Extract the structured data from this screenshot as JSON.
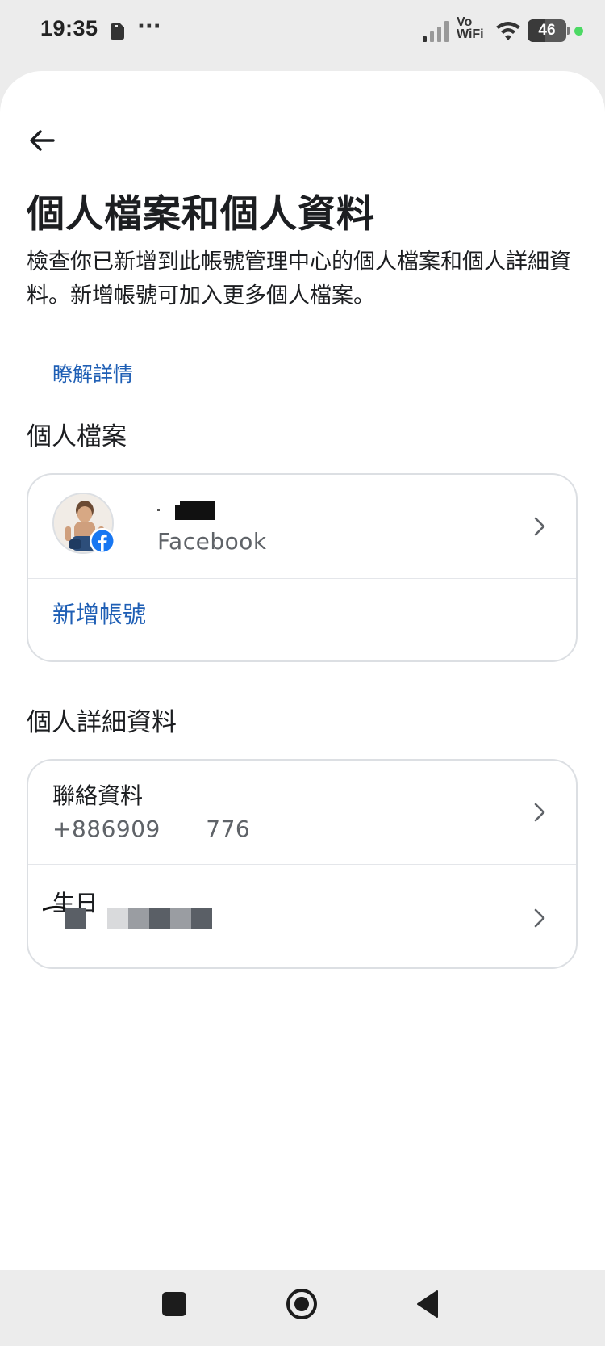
{
  "status_bar": {
    "time": "19:35",
    "overflow_dots": "···",
    "vowifi_top": "Vo",
    "vowifi_bottom": "WiFi",
    "battery_percent": "46",
    "battery_level": 0.46
  },
  "header": {
    "title": "個人檔案和個人資料",
    "description": "檢查你已新增到此帳號管理中心的個人檔案和個人詳細資料。新增帳號可加入更多個人檔案。",
    "learn_more": "瞭解詳情"
  },
  "profiles_section": {
    "heading": "個人檔案",
    "profile": {
      "platform": "Facebook"
    },
    "add_account": "新增帳號"
  },
  "details_section": {
    "heading": "個人詳細資料",
    "contact": {
      "label": "聯絡資料",
      "value": "+886909      776"
    },
    "birthday": {
      "label": "生日"
    }
  },
  "colors": {
    "link_blue": "#1f5fb5",
    "facebook_blue": "#1877f2",
    "text_primary": "#1c1e21",
    "text_secondary": "#5f6368",
    "card_border": "#dcdfe3"
  },
  "icons": {
    "back": "arrow-left-icon",
    "chevron": "chevron-right-icon",
    "facebook": "facebook-logo-icon",
    "nav_recents": "square-icon",
    "nav_home": "circle-icon",
    "nav_back": "triangle-back-icon"
  }
}
